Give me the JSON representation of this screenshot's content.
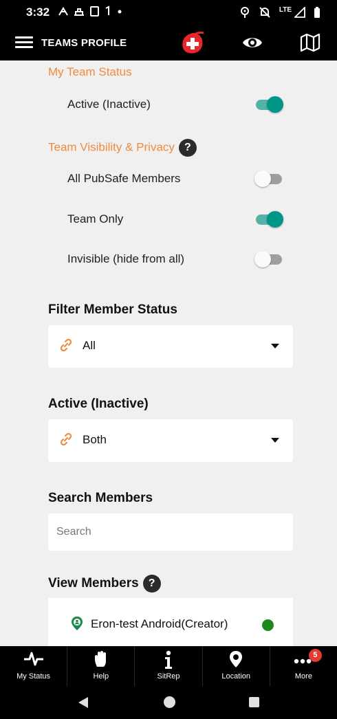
{
  "status_bar": {
    "time": "3:32",
    "network": "LTE"
  },
  "app_bar": {
    "title": "TEAMS PROFILE",
    "icons": [
      "menu-icon",
      "logo-icon",
      "eye-icon",
      "map-icon"
    ]
  },
  "my_team_status": {
    "title": "My Team Status",
    "items": [
      {
        "label": "Active (Inactive)",
        "on": true
      }
    ]
  },
  "visibility": {
    "title": "Team Visibility & Privacy",
    "help": "?",
    "items": [
      {
        "label": "All PubSafe Members",
        "on": false
      },
      {
        "label": "Team Only",
        "on": true
      },
      {
        "label": "Invisible (hide from all)",
        "on": false
      }
    ]
  },
  "filter_member_status": {
    "title": "Filter Member Status",
    "selected": "All"
  },
  "active_filter": {
    "title": "Active (Inactive)",
    "selected": "Both"
  },
  "search_members": {
    "title": "Search Members",
    "placeholder": "Search",
    "value": ""
  },
  "view_members": {
    "title": "View Members",
    "help": "?",
    "members": [
      {
        "name": "Eron-test Android(Creator)",
        "status_color": "#1b8a1b"
      }
    ]
  },
  "bottom_nav": {
    "items": [
      {
        "label": "My Status",
        "icon": "pulse-icon"
      },
      {
        "label": "Help",
        "icon": "hand-icon"
      },
      {
        "label": "SitRep",
        "icon": "info-icon"
      },
      {
        "label": "Location",
        "icon": "location-pin-icon"
      },
      {
        "label": "More",
        "icon": "more-dots-icon",
        "badge": "5"
      }
    ]
  },
  "colors": {
    "accent_orange": "#f08a3c",
    "toggle_on": "#009688",
    "background": "#f0f0f0"
  }
}
